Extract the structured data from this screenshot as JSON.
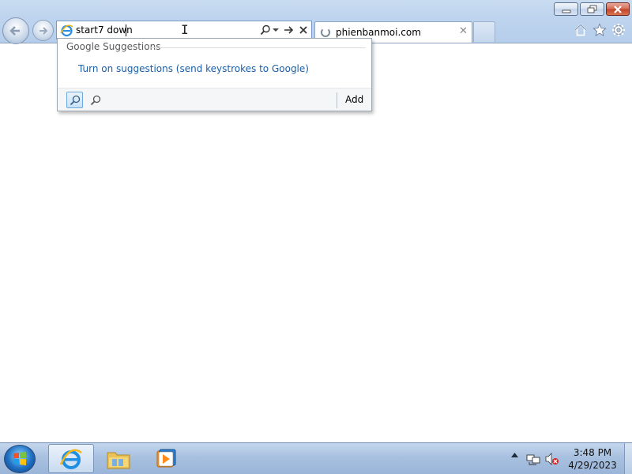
{
  "address_bar": {
    "typed_text": "start7 down"
  },
  "tab": {
    "title": "phienbanmoi.com"
  },
  "dropdown": {
    "section_header": "Google Suggestions",
    "suggestion_link": "Turn on suggestions (send keystrokes to Google)",
    "add_label": "Add"
  },
  "icons": {
    "back": "back-arrow-icon",
    "forward": "forward-arrow-icon",
    "home": "home-icon",
    "favorites": "favorites-star-icon",
    "tools": "tools-gear-icon"
  },
  "taskbar": {
    "clock_time": "3:48 PM",
    "clock_date": "4/29/2023"
  },
  "colors": {
    "link": "#1a5fa8",
    "frame": "#bed4ee",
    "close_button": "#c2432a"
  }
}
